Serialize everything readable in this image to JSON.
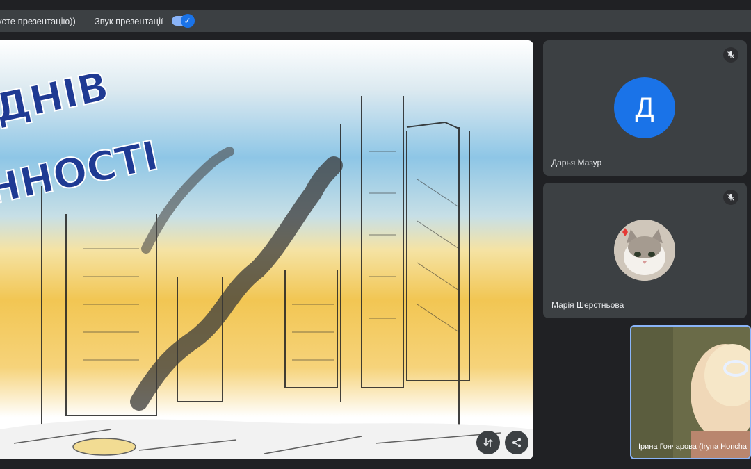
{
  "present_bar": {
    "left_label": "ycте презентацію))",
    "sound_label": "Звук презентації",
    "sound_on": true
  },
  "slide": {
    "title_line1": "ДНІВ",
    "title_line2": "ННОСТІ"
  },
  "participants": [
    {
      "name": "Дарья Мазур",
      "initial": "Д",
      "muted": true
    },
    {
      "name": "Марія Шерстньова",
      "muted": true
    }
  ],
  "self_view": {
    "name": "Ірина Гончарова (Iryna Honcha"
  },
  "colors": {
    "accent": "#1a73e8",
    "tile_bg": "#3c4043",
    "page_bg": "#202124"
  }
}
